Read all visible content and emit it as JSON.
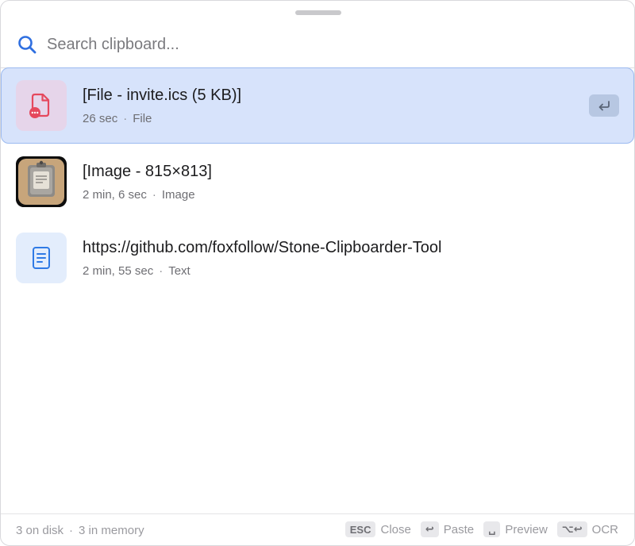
{
  "search": {
    "placeholder": "Search clipboard..."
  },
  "items": [
    {
      "title": "[File - invite.ics (5 KB)]",
      "age": "26 sec",
      "kind": "File",
      "selected": true
    },
    {
      "title": "[Image - 815×813]",
      "age": "2 min, 6 sec",
      "kind": "Image",
      "selected": false
    },
    {
      "title": "https://github.com/foxfollow/Stone-Clipboarder-Tool",
      "age": "2 min, 55 sec",
      "kind": "Text",
      "selected": false
    }
  ],
  "footer": {
    "on_disk": "3 on disk",
    "in_memory": "3 in memory",
    "shortcuts": [
      {
        "key": "ESC",
        "label": "Close"
      },
      {
        "key": "↩",
        "label": "Paste"
      },
      {
        "key": "␣",
        "label": "Preview"
      },
      {
        "key": "⌥↩",
        "label": "OCR"
      }
    ]
  },
  "colors": {
    "accent": "#2f6fe0",
    "selected_bg": "#d7e3fb",
    "selected_border": "#9bbaf0",
    "file_icon": "#e5485d"
  },
  "icons": {
    "search": "search-icon",
    "file": "file-icon",
    "image": "clipboard-app-icon",
    "text": "document-icon",
    "enter": "return-icon"
  }
}
